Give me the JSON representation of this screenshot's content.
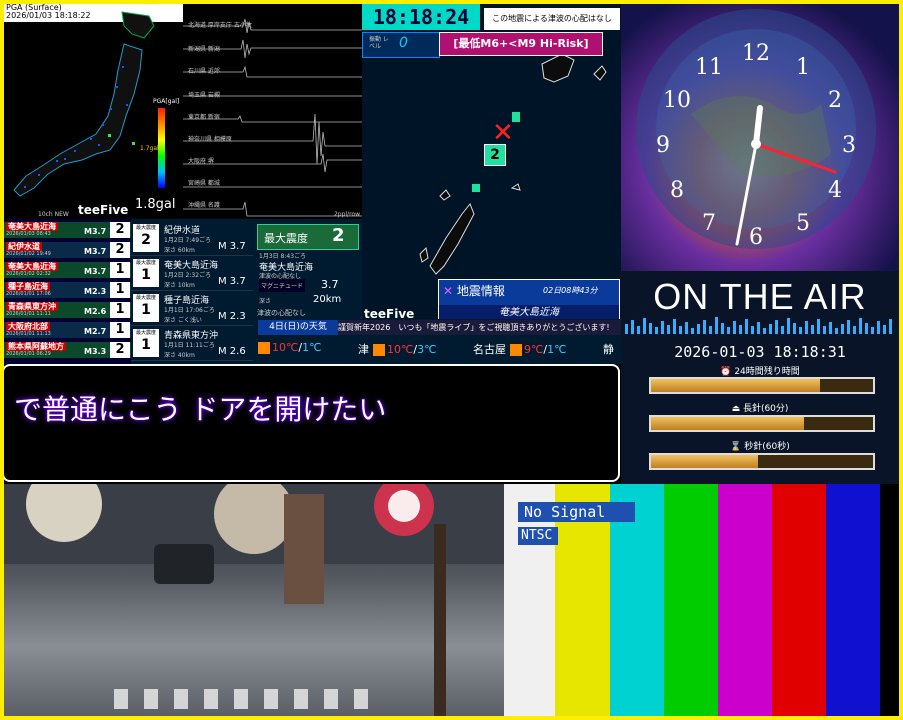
{
  "seismic_map": {
    "header_line1": "PGA (Surface)",
    "header_line2": "2026/01/03 18:18:22",
    "pga_title": "PGA[gal]",
    "value": "1.8gal",
    "max_label": "1.7gal",
    "new_tag": "10ch NEW",
    "brand": "teeFive"
  },
  "waveforms": {
    "stations": [
      "北海道 厚岸支庁 古小牧",
      "新潟県 新潟",
      "石川県 近郊",
      "埼玉県 岩槻",
      "東京都 新宿",
      "神奈川県 相模原",
      "大阪府 堺",
      "宮崎県 都城",
      "沖縄県 名護"
    ],
    "unit": "2ppl/row"
  },
  "quake_list": [
    {
      "place": "奄美大島近海",
      "datetime": "2026/01/03 08:43",
      "mag": "M3.7",
      "intensity": "2"
    },
    {
      "place": "紀伊水道",
      "datetime": "2026/01/02 19:49",
      "mag": "M3.7",
      "intensity": "2"
    },
    {
      "place": "奄美大島近海",
      "datetime": "2026/01/02 02:32",
      "mag": "M3.7",
      "intensity": "1"
    },
    {
      "place": "種子島近海",
      "datetime": "2026/01/01 17:06",
      "mag": "M2.3",
      "intensity": "1"
    },
    {
      "place": "青森県東方沖",
      "datetime": "2026/01/01 11:11",
      "mag": "M2.6",
      "intensity": "1"
    },
    {
      "place": "大阪府北部",
      "datetime": "2026/01/01 11:13",
      "mag": "M2.7",
      "intensity": "1"
    },
    {
      "place": "熊本県阿蘇地方",
      "datetime": "2026/01/01 06:29",
      "mag": "M3.3",
      "intensity": "2"
    }
  ],
  "quake_cards": [
    {
      "badge_label": "最大震度",
      "intensity": "2",
      "name": "紀伊水道",
      "when": "1月2日 7:49ごろ",
      "depth": "深さ 60km",
      "mag": "M 3.7"
    },
    {
      "badge_label": "最大震度",
      "intensity": "1",
      "name": "奄美大島近海",
      "when": "1月2日 2:32ごろ",
      "depth": "深さ 10km",
      "mag": "M 3.7"
    },
    {
      "badge_label": "最大震度",
      "intensity": "1",
      "name": "種子島近海",
      "when": "1月1日 17:06ごろ",
      "depth": "深さ ごく浅い",
      "mag": "M 2.3"
    },
    {
      "badge_label": "最大震度",
      "intensity": "1",
      "name": "青森県東方沖",
      "when": "1月1日 11:11ごろ",
      "depth": "深さ 40km",
      "mag": "M 2.6"
    }
  ],
  "max_intensity": {
    "label": "最大震度",
    "value": "2",
    "when": "1月3日 8:43ごろ",
    "place": "奄美大島近海",
    "tsunami": "津波の心配なし",
    "magnitude_label": "マグニチュード",
    "magnitude": "3.7",
    "depth_label": "深さ",
    "depth": "20km",
    "tsunami_footer": "津波の心配なし"
  },
  "central_map": {
    "clock": "18:18:24",
    "tsunami_note": "この地震による津波の心配はなし",
    "level_label": "振動 レベル",
    "level_value": "0",
    "risk": "[最低M6+<M9 Hi-Risk]",
    "marker_intensity": "2",
    "info_title": "地震情報",
    "info_time": "02日08時43分",
    "info_place": "奄美大島近海",
    "brand": "teeFive"
  },
  "weather": {
    "header": "4日(日)の天気",
    "ticker": "謹賀新年2026　いつも「地震ライブ」をご視聴頂きありがとうございます!",
    "cities": [
      {
        "temp_hi": "10℃",
        "temp_lo": "1℃"
      },
      {
        "name": "津",
        "temp_hi": "10℃",
        "temp_lo": "3℃"
      },
      {
        "name": "名古屋",
        "temp_hi": "9℃",
        "temp_lo": "1℃"
      },
      {
        "name": "静"
      }
    ]
  },
  "subtitle": {
    "text": "で普通にこう ドアを開けたい"
  },
  "clock_panel": {
    "numerals": [
      "12",
      "1",
      "2",
      "3",
      "4",
      "5",
      "6",
      "7",
      "8",
      "9",
      "10",
      "11"
    ]
  },
  "on_air": {
    "title": "ON THE AIR",
    "datetime": "2026-01-03 18:18:31",
    "bars": [
      {
        "label": "24時間残り時間",
        "progress": 0.76
      },
      {
        "label": "長針(60分)",
        "progress": 0.69
      },
      {
        "label": "秒針(60秒)",
        "progress": 0.48
      }
    ]
  },
  "color_bars": {
    "no_signal": "No Signal",
    "ntsc": "NTSC",
    "colors": [
      "#f0f0f0",
      "#e6e600",
      "#00d2d2",
      "#00cc00",
      "#cc00cc",
      "#e00000",
      "#1010d0",
      "#000000"
    ]
  },
  "colors": {
    "frame": "#ffee00",
    "accent": "#00d8c8",
    "risk": "#b01070"
  }
}
